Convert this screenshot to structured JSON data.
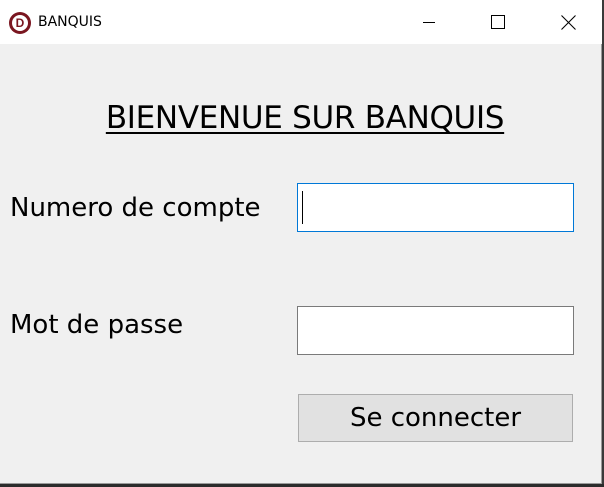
{
  "window": {
    "title": "BANQUIS",
    "app_icon_letter": "D",
    "icons": {
      "app": "app-logo-icon",
      "minimize": "minimize-icon",
      "maximize": "maximize-icon",
      "close": "close-icon"
    },
    "accent_color": "#7a1620"
  },
  "form": {
    "heading": "BIENVENUE SUR BANQUIS",
    "account_label": "Numero de compte",
    "account_value": "",
    "password_label": "Mot de passe",
    "password_value": "",
    "submit_label": "Se connecter",
    "focus_color": "#0078d7"
  }
}
